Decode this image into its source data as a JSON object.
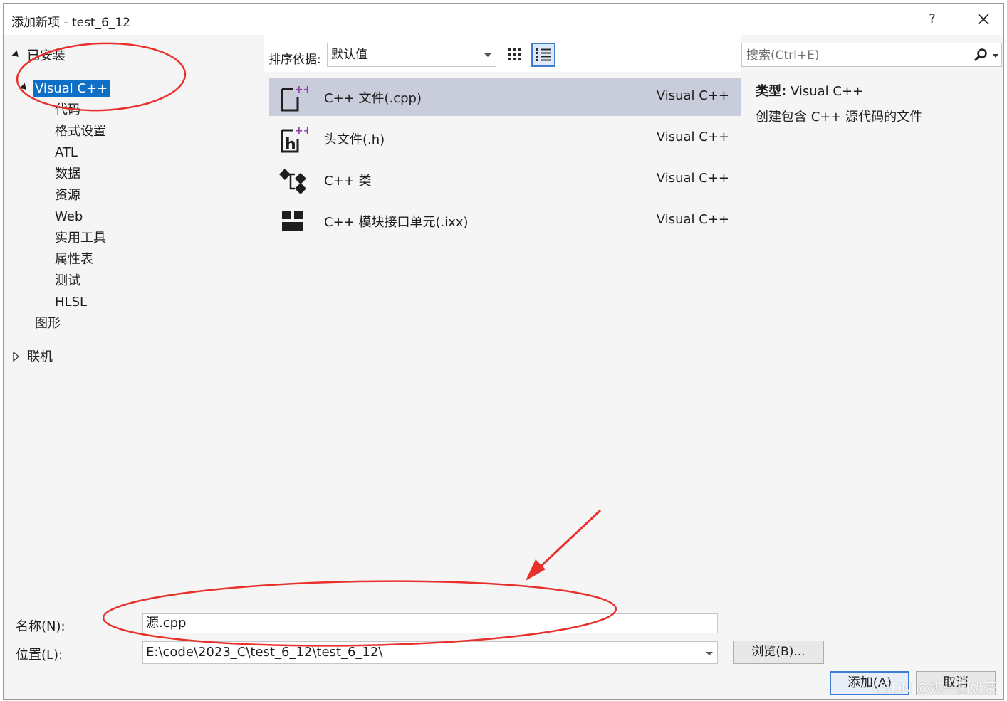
{
  "window": {
    "title": "添加新项 - test_6_12",
    "help_label": "?"
  },
  "tree": {
    "installed": "已安装",
    "visual_cpp": "Visual C++",
    "children": [
      "代码",
      "格式设置",
      "ATL",
      "数据",
      "资源",
      "Web",
      "实用工具",
      "属性表",
      "测试",
      "HLSL"
    ],
    "graphics": "图形",
    "online": "联机"
  },
  "toolbar": {
    "sort_label": "排序依据:",
    "sort_value": "默认值"
  },
  "templates": [
    {
      "name": "C++ 文件(.cpp)",
      "lang": "Visual C++",
      "icon": "cpp-file-icon",
      "selected": true
    },
    {
      "name": "头文件(.h)",
      "lang": "Visual C++",
      "icon": "header-file-icon",
      "selected": false
    },
    {
      "name": "C++ 类",
      "lang": "Visual C++",
      "icon": "cpp-class-icon",
      "selected": false
    },
    {
      "name": "C++ 模块接口单元(.ixx)",
      "lang": "Visual C++",
      "icon": "module-interface-icon",
      "selected": false
    }
  ],
  "details": {
    "search_placeholder": "搜索(Ctrl+E)",
    "type_label": "类型:",
    "type_value": "Visual C++",
    "description": "创建包含 C++ 源代码的文件"
  },
  "form": {
    "name_label": "名称(N):",
    "name_value": "源.cpp",
    "location_label": "位置(L):",
    "location_value": "E:\\code\\2023_C\\test_6_12\\test_6_12\\",
    "browse_label": "浏览(B)...",
    "add_label": "添加(A)",
    "cancel_label": "取消"
  },
  "watermark": "CSDN @奶一口奶茶",
  "colors": {
    "accent": "#0e6fc7",
    "selected_row": "#c9ccdb",
    "annotation_red": "#e8302c",
    "icon_purple": "#8b3fa0"
  }
}
